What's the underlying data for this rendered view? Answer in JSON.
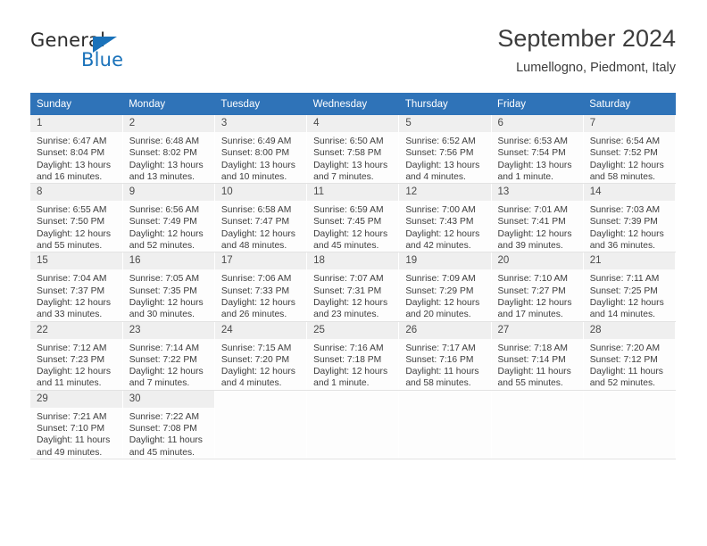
{
  "brand": {
    "name_top": "General",
    "name_bottom": "Blue",
    "accent_color": "#1a72ba"
  },
  "header": {
    "title": "September 2024",
    "subtitle": "Lumellogno, Piedmont, Italy"
  },
  "theme": {
    "header_blue": "#2f73b8",
    "daynum_band": "#efefef",
    "text": "#3d3d3d"
  },
  "calendar": {
    "weekday_headers": [
      "Sunday",
      "Monday",
      "Tuesday",
      "Wednesday",
      "Thursday",
      "Friday",
      "Saturday"
    ],
    "labels": {
      "sunrise": "Sunrise:",
      "sunset": "Sunset:",
      "daylight": "Daylight:"
    },
    "weeks": [
      [
        {
          "day": "1",
          "sunrise": "Sunrise: 6:47 AM",
          "sunset": "Sunset: 8:04 PM",
          "daylight_l1": "Daylight: 13 hours",
          "daylight_l2": "and 16 minutes."
        },
        {
          "day": "2",
          "sunrise": "Sunrise: 6:48 AM",
          "sunset": "Sunset: 8:02 PM",
          "daylight_l1": "Daylight: 13 hours",
          "daylight_l2": "and 13 minutes."
        },
        {
          "day": "3",
          "sunrise": "Sunrise: 6:49 AM",
          "sunset": "Sunset: 8:00 PM",
          "daylight_l1": "Daylight: 13 hours",
          "daylight_l2": "and 10 minutes."
        },
        {
          "day": "4",
          "sunrise": "Sunrise: 6:50 AM",
          "sunset": "Sunset: 7:58 PM",
          "daylight_l1": "Daylight: 13 hours",
          "daylight_l2": "and 7 minutes."
        },
        {
          "day": "5",
          "sunrise": "Sunrise: 6:52 AM",
          "sunset": "Sunset: 7:56 PM",
          "daylight_l1": "Daylight: 13 hours",
          "daylight_l2": "and 4 minutes."
        },
        {
          "day": "6",
          "sunrise": "Sunrise: 6:53 AM",
          "sunset": "Sunset: 7:54 PM",
          "daylight_l1": "Daylight: 13 hours",
          "daylight_l2": "and 1 minute."
        },
        {
          "day": "7",
          "sunrise": "Sunrise: 6:54 AM",
          "sunset": "Sunset: 7:52 PM",
          "daylight_l1": "Daylight: 12 hours",
          "daylight_l2": "and 58 minutes."
        }
      ],
      [
        {
          "day": "8",
          "sunrise": "Sunrise: 6:55 AM",
          "sunset": "Sunset: 7:50 PM",
          "daylight_l1": "Daylight: 12 hours",
          "daylight_l2": "and 55 minutes."
        },
        {
          "day": "9",
          "sunrise": "Sunrise: 6:56 AM",
          "sunset": "Sunset: 7:49 PM",
          "daylight_l1": "Daylight: 12 hours",
          "daylight_l2": "and 52 minutes."
        },
        {
          "day": "10",
          "sunrise": "Sunrise: 6:58 AM",
          "sunset": "Sunset: 7:47 PM",
          "daylight_l1": "Daylight: 12 hours",
          "daylight_l2": "and 48 minutes."
        },
        {
          "day": "11",
          "sunrise": "Sunrise: 6:59 AM",
          "sunset": "Sunset: 7:45 PM",
          "daylight_l1": "Daylight: 12 hours",
          "daylight_l2": "and 45 minutes."
        },
        {
          "day": "12",
          "sunrise": "Sunrise: 7:00 AM",
          "sunset": "Sunset: 7:43 PM",
          "daylight_l1": "Daylight: 12 hours",
          "daylight_l2": "and 42 minutes."
        },
        {
          "day": "13",
          "sunrise": "Sunrise: 7:01 AM",
          "sunset": "Sunset: 7:41 PM",
          "daylight_l1": "Daylight: 12 hours",
          "daylight_l2": "and 39 minutes."
        },
        {
          "day": "14",
          "sunrise": "Sunrise: 7:03 AM",
          "sunset": "Sunset: 7:39 PM",
          "daylight_l1": "Daylight: 12 hours",
          "daylight_l2": "and 36 minutes."
        }
      ],
      [
        {
          "day": "15",
          "sunrise": "Sunrise: 7:04 AM",
          "sunset": "Sunset: 7:37 PM",
          "daylight_l1": "Daylight: 12 hours",
          "daylight_l2": "and 33 minutes."
        },
        {
          "day": "16",
          "sunrise": "Sunrise: 7:05 AM",
          "sunset": "Sunset: 7:35 PM",
          "daylight_l1": "Daylight: 12 hours",
          "daylight_l2": "and 30 minutes."
        },
        {
          "day": "17",
          "sunrise": "Sunrise: 7:06 AM",
          "sunset": "Sunset: 7:33 PM",
          "daylight_l1": "Daylight: 12 hours",
          "daylight_l2": "and 26 minutes."
        },
        {
          "day": "18",
          "sunrise": "Sunrise: 7:07 AM",
          "sunset": "Sunset: 7:31 PM",
          "daylight_l1": "Daylight: 12 hours",
          "daylight_l2": "and 23 minutes."
        },
        {
          "day": "19",
          "sunrise": "Sunrise: 7:09 AM",
          "sunset": "Sunset: 7:29 PM",
          "daylight_l1": "Daylight: 12 hours",
          "daylight_l2": "and 20 minutes."
        },
        {
          "day": "20",
          "sunrise": "Sunrise: 7:10 AM",
          "sunset": "Sunset: 7:27 PM",
          "daylight_l1": "Daylight: 12 hours",
          "daylight_l2": "and 17 minutes."
        },
        {
          "day": "21",
          "sunrise": "Sunrise: 7:11 AM",
          "sunset": "Sunset: 7:25 PM",
          "daylight_l1": "Daylight: 12 hours",
          "daylight_l2": "and 14 minutes."
        }
      ],
      [
        {
          "day": "22",
          "sunrise": "Sunrise: 7:12 AM",
          "sunset": "Sunset: 7:23 PM",
          "daylight_l1": "Daylight: 12 hours",
          "daylight_l2": "and 11 minutes."
        },
        {
          "day": "23",
          "sunrise": "Sunrise: 7:14 AM",
          "sunset": "Sunset: 7:22 PM",
          "daylight_l1": "Daylight: 12 hours",
          "daylight_l2": "and 7 minutes."
        },
        {
          "day": "24",
          "sunrise": "Sunrise: 7:15 AM",
          "sunset": "Sunset: 7:20 PM",
          "daylight_l1": "Daylight: 12 hours",
          "daylight_l2": "and 4 minutes."
        },
        {
          "day": "25",
          "sunrise": "Sunrise: 7:16 AM",
          "sunset": "Sunset: 7:18 PM",
          "daylight_l1": "Daylight: 12 hours",
          "daylight_l2": "and 1 minute."
        },
        {
          "day": "26",
          "sunrise": "Sunrise: 7:17 AM",
          "sunset": "Sunset: 7:16 PM",
          "daylight_l1": "Daylight: 11 hours",
          "daylight_l2": "and 58 minutes."
        },
        {
          "day": "27",
          "sunrise": "Sunrise: 7:18 AM",
          "sunset": "Sunset: 7:14 PM",
          "daylight_l1": "Daylight: 11 hours",
          "daylight_l2": "and 55 minutes."
        },
        {
          "day": "28",
          "sunrise": "Sunrise: 7:20 AM",
          "sunset": "Sunset: 7:12 PM",
          "daylight_l1": "Daylight: 11 hours",
          "daylight_l2": "and 52 minutes."
        }
      ],
      [
        {
          "day": "29",
          "sunrise": "Sunrise: 7:21 AM",
          "sunset": "Sunset: 7:10 PM",
          "daylight_l1": "Daylight: 11 hours",
          "daylight_l2": "and 49 minutes."
        },
        {
          "day": "30",
          "sunrise": "Sunrise: 7:22 AM",
          "sunset": "Sunset: 7:08 PM",
          "daylight_l1": "Daylight: 11 hours",
          "daylight_l2": "and 45 minutes."
        },
        {
          "day": "",
          "sunrise": "",
          "sunset": "",
          "daylight_l1": "",
          "daylight_l2": ""
        },
        {
          "day": "",
          "sunrise": "",
          "sunset": "",
          "daylight_l1": "",
          "daylight_l2": ""
        },
        {
          "day": "",
          "sunrise": "",
          "sunset": "",
          "daylight_l1": "",
          "daylight_l2": ""
        },
        {
          "day": "",
          "sunrise": "",
          "sunset": "",
          "daylight_l1": "",
          "daylight_l2": ""
        },
        {
          "day": "",
          "sunrise": "",
          "sunset": "",
          "daylight_l1": "",
          "daylight_l2": ""
        }
      ]
    ]
  }
}
